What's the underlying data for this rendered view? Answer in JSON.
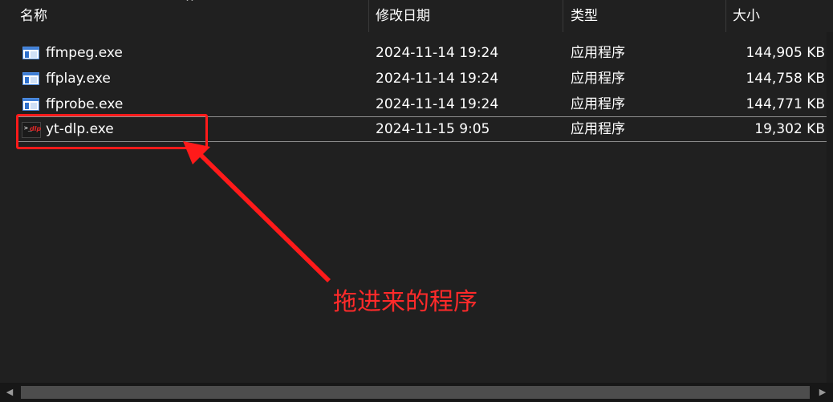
{
  "header": {
    "name": "名称",
    "modified": "修改日期",
    "type": "类型",
    "size": "大小",
    "sort_indicator": "^"
  },
  "files": [
    {
      "name": "ffmpeg.exe",
      "modified": "2024-11-14 19:24",
      "type": "应用程序",
      "size": "144,905 KB",
      "icon": "exe-app-icon"
    },
    {
      "name": "ffplay.exe",
      "modified": "2024-11-14 19:24",
      "type": "应用程序",
      "size": "144,758 KB",
      "icon": "exe-app-icon"
    },
    {
      "name": "ffprobe.exe",
      "modified": "2024-11-14 19:24",
      "type": "应用程序",
      "size": "144,771 KB",
      "icon": "exe-app-icon"
    },
    {
      "name": "yt-dlp.exe",
      "modified": "2024-11-15 9:05",
      "type": "应用程序",
      "size": "19,302 KB",
      "icon": "yt-dlp-icon"
    }
  ],
  "ytdlp_icon": {
    "prompt": ">_",
    "mark": "dlp"
  },
  "annotation": {
    "text": "拖进来的程序",
    "color": "#ff2a2a"
  },
  "scrollbar": {
    "left_arrow": "◀",
    "right_arrow": "▶"
  },
  "colors": {
    "background": "#202020",
    "highlight": "#ff1a1a",
    "selection_border": "#8f8f8f"
  }
}
